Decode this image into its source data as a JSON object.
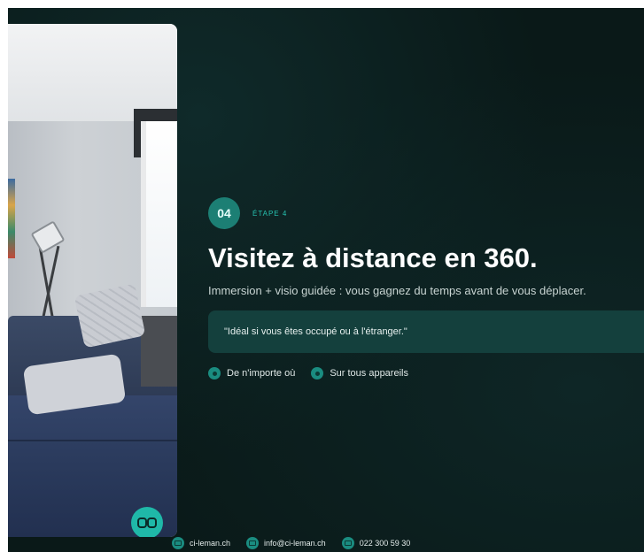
{
  "step": {
    "number": "04",
    "label": "ÉTAPE 4"
  },
  "title": "Visitez à distance en 360.",
  "subtitle": "Immersion + visio guidée : vous gagnez du temps avant de vous déplacer.",
  "quote": "\"Idéal si vous êtes occupé ou à l'étranger.\"",
  "features": [
    {
      "label": "De n'importe où",
      "icon": "location-dot-icon"
    },
    {
      "label": "Sur tous appareils",
      "icon": "device-dot-icon"
    }
  ],
  "footer": {
    "website": "ci-leman.ch",
    "email": "info@ci-leman.ch",
    "phone": "022 300 59 30"
  },
  "vr_button": {
    "icon": "vr-goggles-icon"
  },
  "colors": {
    "background": "#0a1918",
    "accent": "#1fb8a8",
    "step_circle": "#1c7f74",
    "quote_box": "#14403d"
  }
}
